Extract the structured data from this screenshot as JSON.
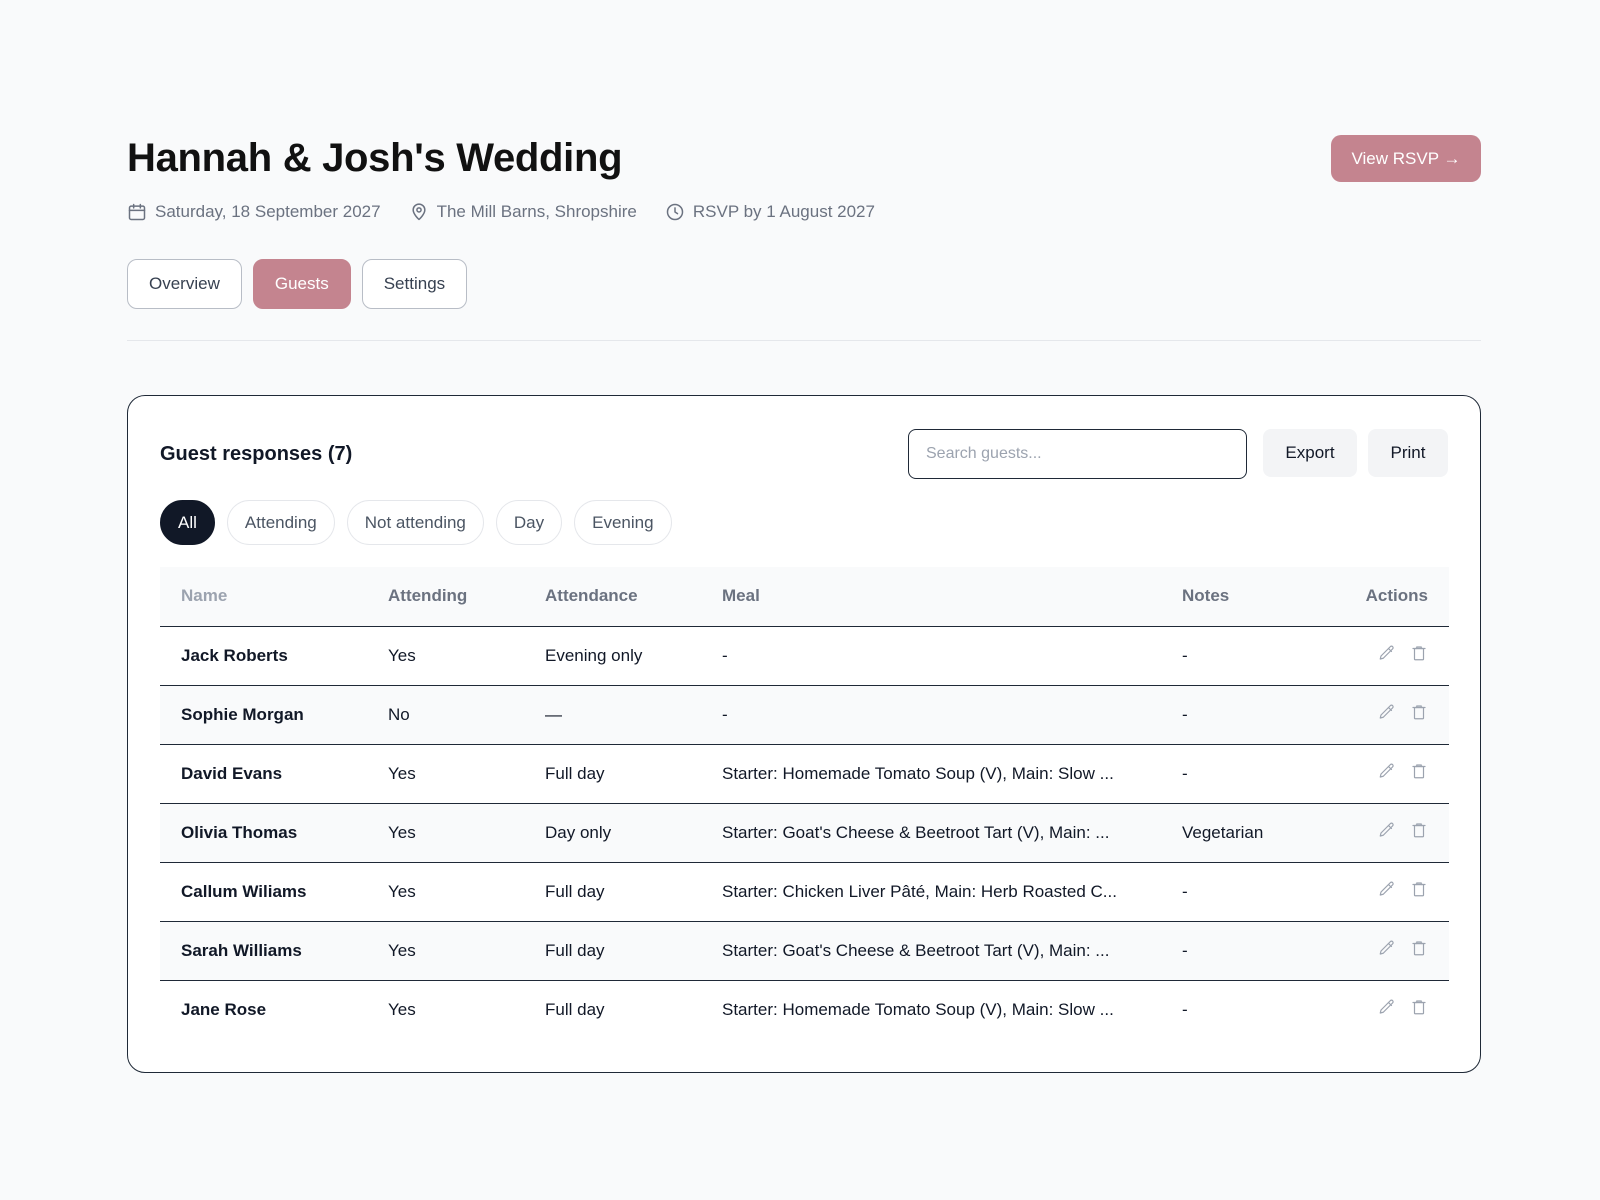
{
  "header": {
    "title": "Hannah & Josh's Wedding",
    "view_rsvp_label": "View RSVP →",
    "meta": {
      "date": "Saturday, 18 September 2027",
      "venue": "The Mill Barns, Shropshire",
      "rsvp_by": "RSVP by 1 August 2027"
    },
    "icons": {
      "date": "calendar-icon",
      "venue": "map-pin-icon",
      "rsvp_by": "clock-icon"
    }
  },
  "tabs": [
    {
      "label": "Overview",
      "active": false
    },
    {
      "label": "Guests",
      "active": true
    },
    {
      "label": "Settings",
      "active": false
    }
  ],
  "colors": {
    "accent": "#c4848f",
    "yes": "#16a34a",
    "no": "#9ca3af",
    "dark": "#111827"
  },
  "guests_panel": {
    "title": "Guest responses (7)",
    "search_placeholder": "Search guests...",
    "export_label": "Export",
    "print_label": "Print",
    "filters": [
      {
        "label": "All",
        "active": true
      },
      {
        "label": "Attending",
        "active": false
      },
      {
        "label": "Not attending",
        "active": false
      },
      {
        "label": "Day",
        "active": false
      },
      {
        "label": "Evening",
        "active": false
      }
    ],
    "columns": [
      "Name",
      "Attending",
      "Attendance",
      "Meal",
      "Notes",
      "Actions"
    ],
    "rows": [
      {
        "name": "Jack Roberts",
        "attending": "Yes",
        "attendance": "Evening only",
        "meal": "-",
        "notes": "-"
      },
      {
        "name": "Sophie Morgan",
        "attending": "No",
        "attendance": "—",
        "meal": "-",
        "notes": "-"
      },
      {
        "name": "David Evans",
        "attending": "Yes",
        "attendance": "Full day",
        "meal": "Starter: Homemade Tomato Soup (V), Main: Slow ...",
        "notes": "-"
      },
      {
        "name": "Olivia Thomas",
        "attending": "Yes",
        "attendance": "Day only",
        "meal": "Starter: Goat's Cheese & Beetroot Tart (V), Main: ...",
        "notes": "Vegetarian"
      },
      {
        "name": "Callum Wiliams",
        "attending": "Yes",
        "attendance": "Full day",
        "meal": "Starter: Chicken Liver Pâté, Main: Herb Roasted C...",
        "notes": "-"
      },
      {
        "name": "Sarah Williams",
        "attending": "Yes",
        "attendance": "Full day",
        "meal": "Starter: Goat's Cheese & Beetroot Tart (V), Main: ...",
        "notes": "-"
      },
      {
        "name": "Jane Rose",
        "attending": "Yes",
        "attendance": "Full day",
        "meal": "Starter: Homemade Tomato Soup (V), Main: Slow ...",
        "notes": "-"
      }
    ],
    "row_action_icons": [
      "pencil-icon",
      "trash-icon"
    ]
  }
}
